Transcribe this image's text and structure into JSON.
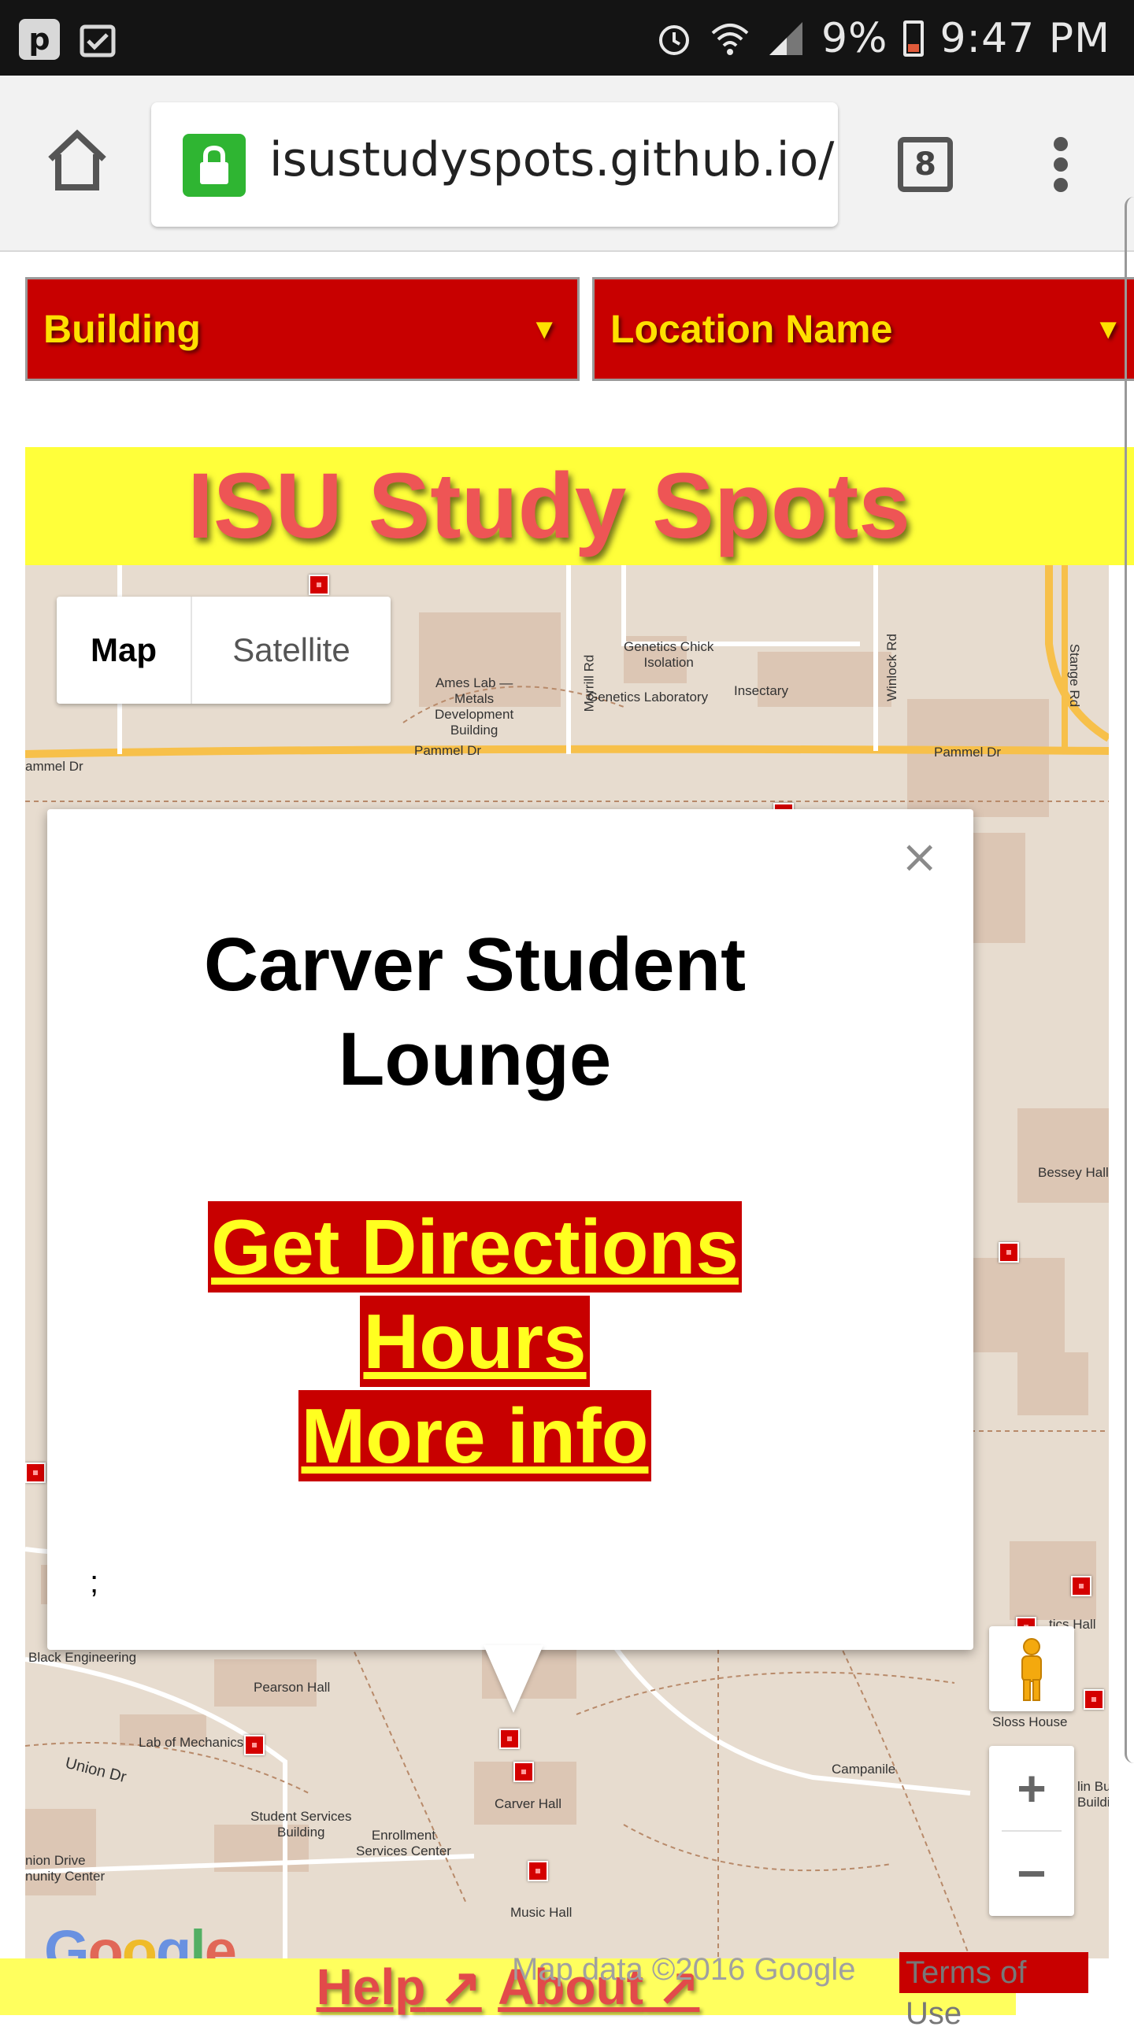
{
  "status_bar": {
    "battery_pct": "9%",
    "time": "9:47 PM",
    "left_icon_1": "p-icon",
    "left_icon_2": "clipboard-check-icon"
  },
  "browser": {
    "url": "isustudyspots.github.io/",
    "tab_count": "8",
    "home_icon": "home-icon",
    "lock_icon": "lock-icon",
    "menu_icon": "more-vert-icon"
  },
  "filters": {
    "building": "Building",
    "location_name": "Location Name"
  },
  "banner": {
    "title": "ISU Study Spots"
  },
  "map": {
    "type_map": "Map",
    "type_satellite": "Satellite",
    "labels": {
      "ames_lab": "Ames Lab —\nMetals\nDevelopment\nBuilding",
      "morrill_rd": "Morrill Rd",
      "genetics_chick": "Genetics Chick\nIsolation",
      "genetics_lab": "Genetics Laboratory",
      "insectary": "Insectary",
      "winlock_rd": "Winlock Rd",
      "stange_rd": "Stange Rd",
      "pammel_dr_1": "Pammel Dr",
      "pammel_dr_2": "Pammel Dr",
      "pammel_dr_left": "ammel Dr",
      "bessey_hall": "Bessey Hall",
      "black_eng": "Black Engineering",
      "pearson_hall": "Pearson Hall",
      "lab_mechanics": "Lab of Mechanics",
      "union_dr": "Union Dr",
      "student_services": "Student Services\nBuilding",
      "enrollment": "Enrollment\nServices Center",
      "carver_hall": "Carver Hall",
      "campanile": "Campanile",
      "sloss_house": "Sloss House",
      "music_hall": "Music Hall",
      "union_drive_cc": "nion Drive\nnunity Center",
      "tics_hall": "tics Hall",
      "lin_bu": "lin Bu\nBuildi"
    },
    "attribution": "Map data ©2016 Google",
    "terms": "Terms of Use",
    "google_logo": "Google"
  },
  "info_window": {
    "title": "Carver Student Lounge",
    "link_directions": "Get Directions",
    "link_hours": "Hours",
    "link_more": "More info",
    "trailing": ";",
    "close": "×"
  },
  "footer": {
    "help": "Help",
    "about": "About"
  },
  "colors": {
    "isu_red": "#c80000",
    "isu_gold": "#ffe000",
    "banner_yellow": "#ffff3a",
    "title_red": "#ee5555"
  }
}
